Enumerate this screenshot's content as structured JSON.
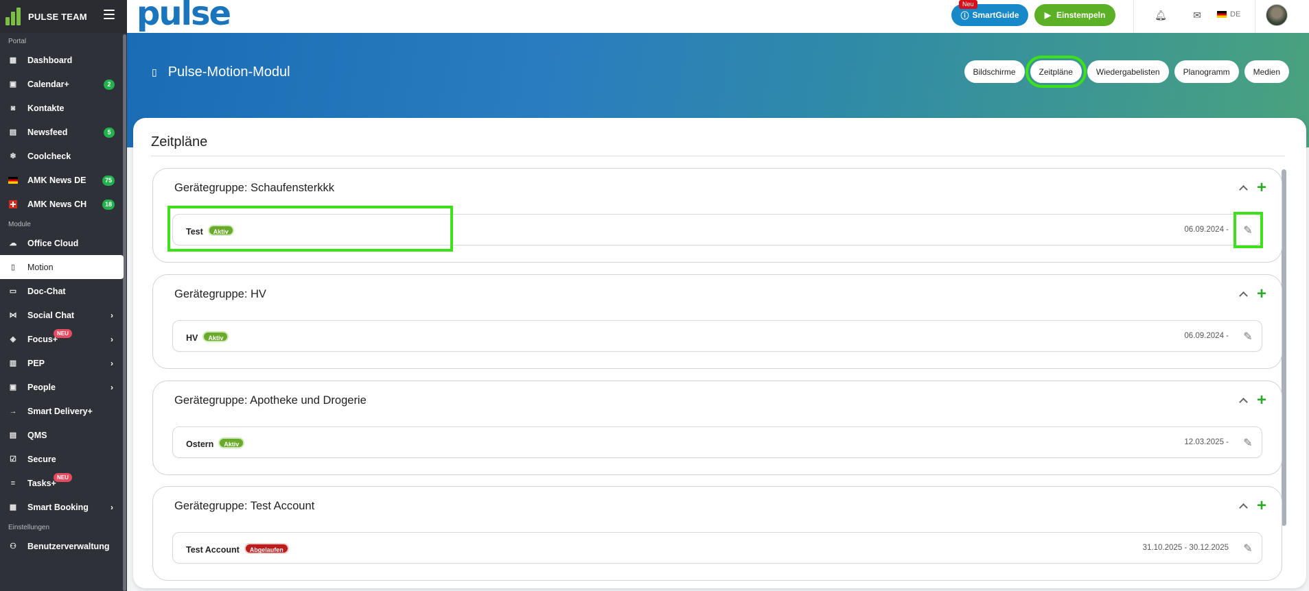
{
  "sidebar": {
    "team": "PULSE TEAM",
    "sections": {
      "portal": "Portal",
      "module": "Module",
      "settings": "Einstellungen"
    },
    "portal_items": [
      {
        "label": "Dashboard",
        "icon": "dashboard-icon"
      },
      {
        "label": "Calendar+",
        "icon": "calendar-icon",
        "badge": "2"
      },
      {
        "label": "Kontakte",
        "icon": "contacts-icon"
      },
      {
        "label": "Newsfeed",
        "icon": "newsfeed-icon",
        "badge": "5"
      },
      {
        "label": "Coolcheck",
        "icon": "coolcheck-icon"
      },
      {
        "label": "AMK News DE",
        "icon": "flag-de-icon",
        "badge": "75"
      },
      {
        "label": "AMK News CH",
        "icon": "flag-ch-icon",
        "badge": "18"
      }
    ],
    "module_items": [
      {
        "label": "Office Cloud",
        "icon": "cloud-icon"
      },
      {
        "label": "Motion",
        "icon": "phone-icon"
      },
      {
        "label": "Doc-Chat",
        "icon": "chat-icon"
      },
      {
        "label": "Social Chat",
        "icon": "share-icon"
      },
      {
        "label": "Focus+",
        "icon": "graduation-icon",
        "neu": "NEU"
      },
      {
        "label": "PEP",
        "icon": "clipboard-icon"
      },
      {
        "label": "People",
        "icon": "people-icon"
      },
      {
        "label": "Smart Delivery+",
        "icon": "arrow-icon"
      },
      {
        "label": "QMS",
        "icon": "qms-icon"
      },
      {
        "label": "Secure",
        "icon": "check-icon"
      },
      {
        "label": "Tasks+",
        "icon": "list-icon",
        "neu": "NEU"
      },
      {
        "label": "Smart Booking",
        "icon": "booking-icon"
      }
    ],
    "settings_items": [
      {
        "label": "Benutzerverwaltung",
        "icon": "users-icon"
      }
    ]
  },
  "topbar": {
    "brand": "pulse",
    "smartguide_tag": "Neu",
    "smartguide": "SmartGuide",
    "stamp": "Einstempeln",
    "lang": "DE"
  },
  "hero": {
    "title": "Pulse-Motion-Modul",
    "tabs": [
      "Bildschirme",
      "Zeitpläne",
      "Wiedergabelisten",
      "Planogramm",
      "Medien"
    ],
    "active_tab": "Zeitpläne"
  },
  "main": {
    "title": "Zeitpläne",
    "groups": [
      {
        "title": "Gerätegruppe: Schaufensterkkk",
        "row": {
          "name": "Test",
          "status": "Aktiv",
          "dates": "06.09.2024 -"
        }
      },
      {
        "title": "Gerätegruppe: HV",
        "row": {
          "name": "HV",
          "status": "Aktiv",
          "dates": "06.09.2024 -"
        }
      },
      {
        "title": "Gerätegruppe: Apotheke und Drogerie",
        "row": {
          "name": "Ostern",
          "status": "Aktiv",
          "dates": "12.03.2025 -"
        }
      },
      {
        "title": "Gerätegruppe: Test Account",
        "row": {
          "name": "Test Account",
          "status": "Abgelaufen",
          "dates": "31.10.2025 - 30.12.2025"
        }
      }
    ]
  },
  "colors": {
    "accent_green": "#5bb025",
    "highlight": "#3ee01a",
    "brand_blue": "#1b75bc",
    "expired": "#b91d1d"
  }
}
